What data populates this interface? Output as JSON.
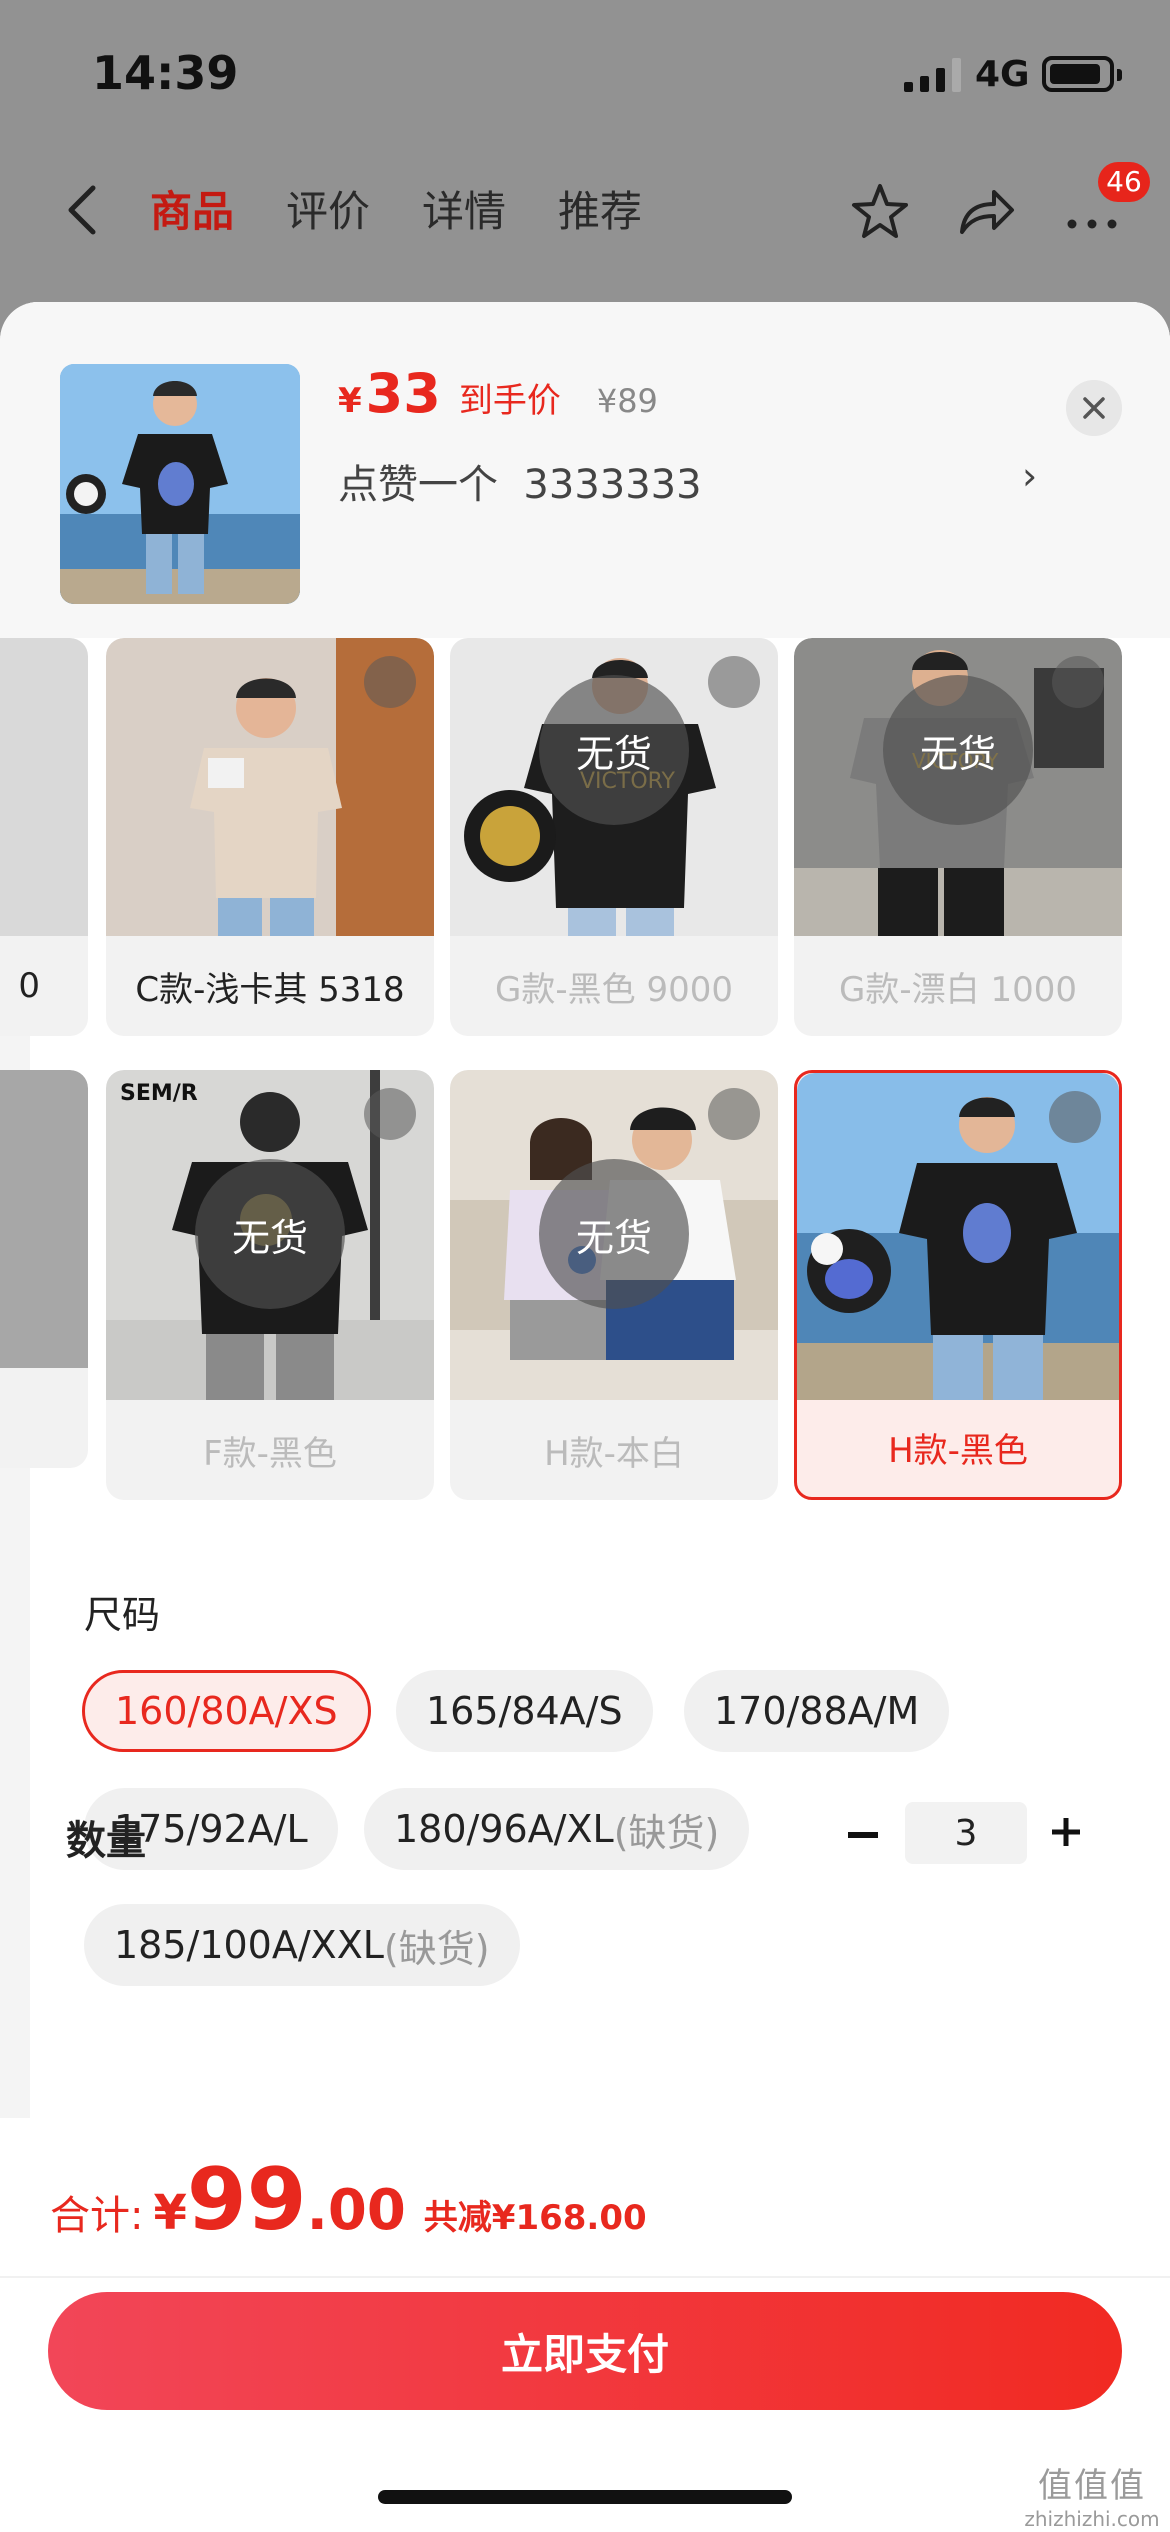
{
  "status": {
    "time": "14:39",
    "network": "4G"
  },
  "nav": {
    "tabs": [
      "商品",
      "评价",
      "详情",
      "推荐"
    ],
    "badge": "46"
  },
  "header": {
    "price_symbol": "¥",
    "price": "33",
    "price_tag": "到手价",
    "original_price": "¥89",
    "like_text": "点赞一个  3333333"
  },
  "variants": {
    "left_partial_label": "0",
    "row1": [
      {
        "label": "C款-浅卡其 5318",
        "status": ""
      },
      {
        "label": "G款-黑色 9000",
        "status": "无货"
      },
      {
        "label": "G款-漂白 1000",
        "status": "无货"
      }
    ],
    "row2": [
      {
        "label": "F款-黑色",
        "status": "无货"
      },
      {
        "label": "H款-本白",
        "status": "无货"
      },
      {
        "label": "H款-黑色",
        "status": ""
      }
    ]
  },
  "sizes": {
    "title": "尺码",
    "options": [
      {
        "label": "160/80A/XS",
        "note": ""
      },
      {
        "label": "165/84A/S",
        "note": ""
      },
      {
        "label": "170/88A/M",
        "note": ""
      },
      {
        "label": "175/92A/L",
        "note": ""
      },
      {
        "label": "180/96A/XL",
        "note": "(缺货)"
      },
      {
        "label": "185/100A/XXL",
        "note": "(缺货)"
      }
    ]
  },
  "quantity": {
    "title": "数量",
    "value": "3"
  },
  "footer": {
    "total_label": "合计:",
    "currency": "¥",
    "total_int": "99",
    "total_dec": ".00",
    "discount": "共减¥168.00",
    "pay_label": "立即支付"
  },
  "watermark": {
    "line1": "值值值",
    "line2": "zhizhizhi.com"
  },
  "colors": {
    "accent": "#e8281e",
    "button": "#f12a22"
  }
}
